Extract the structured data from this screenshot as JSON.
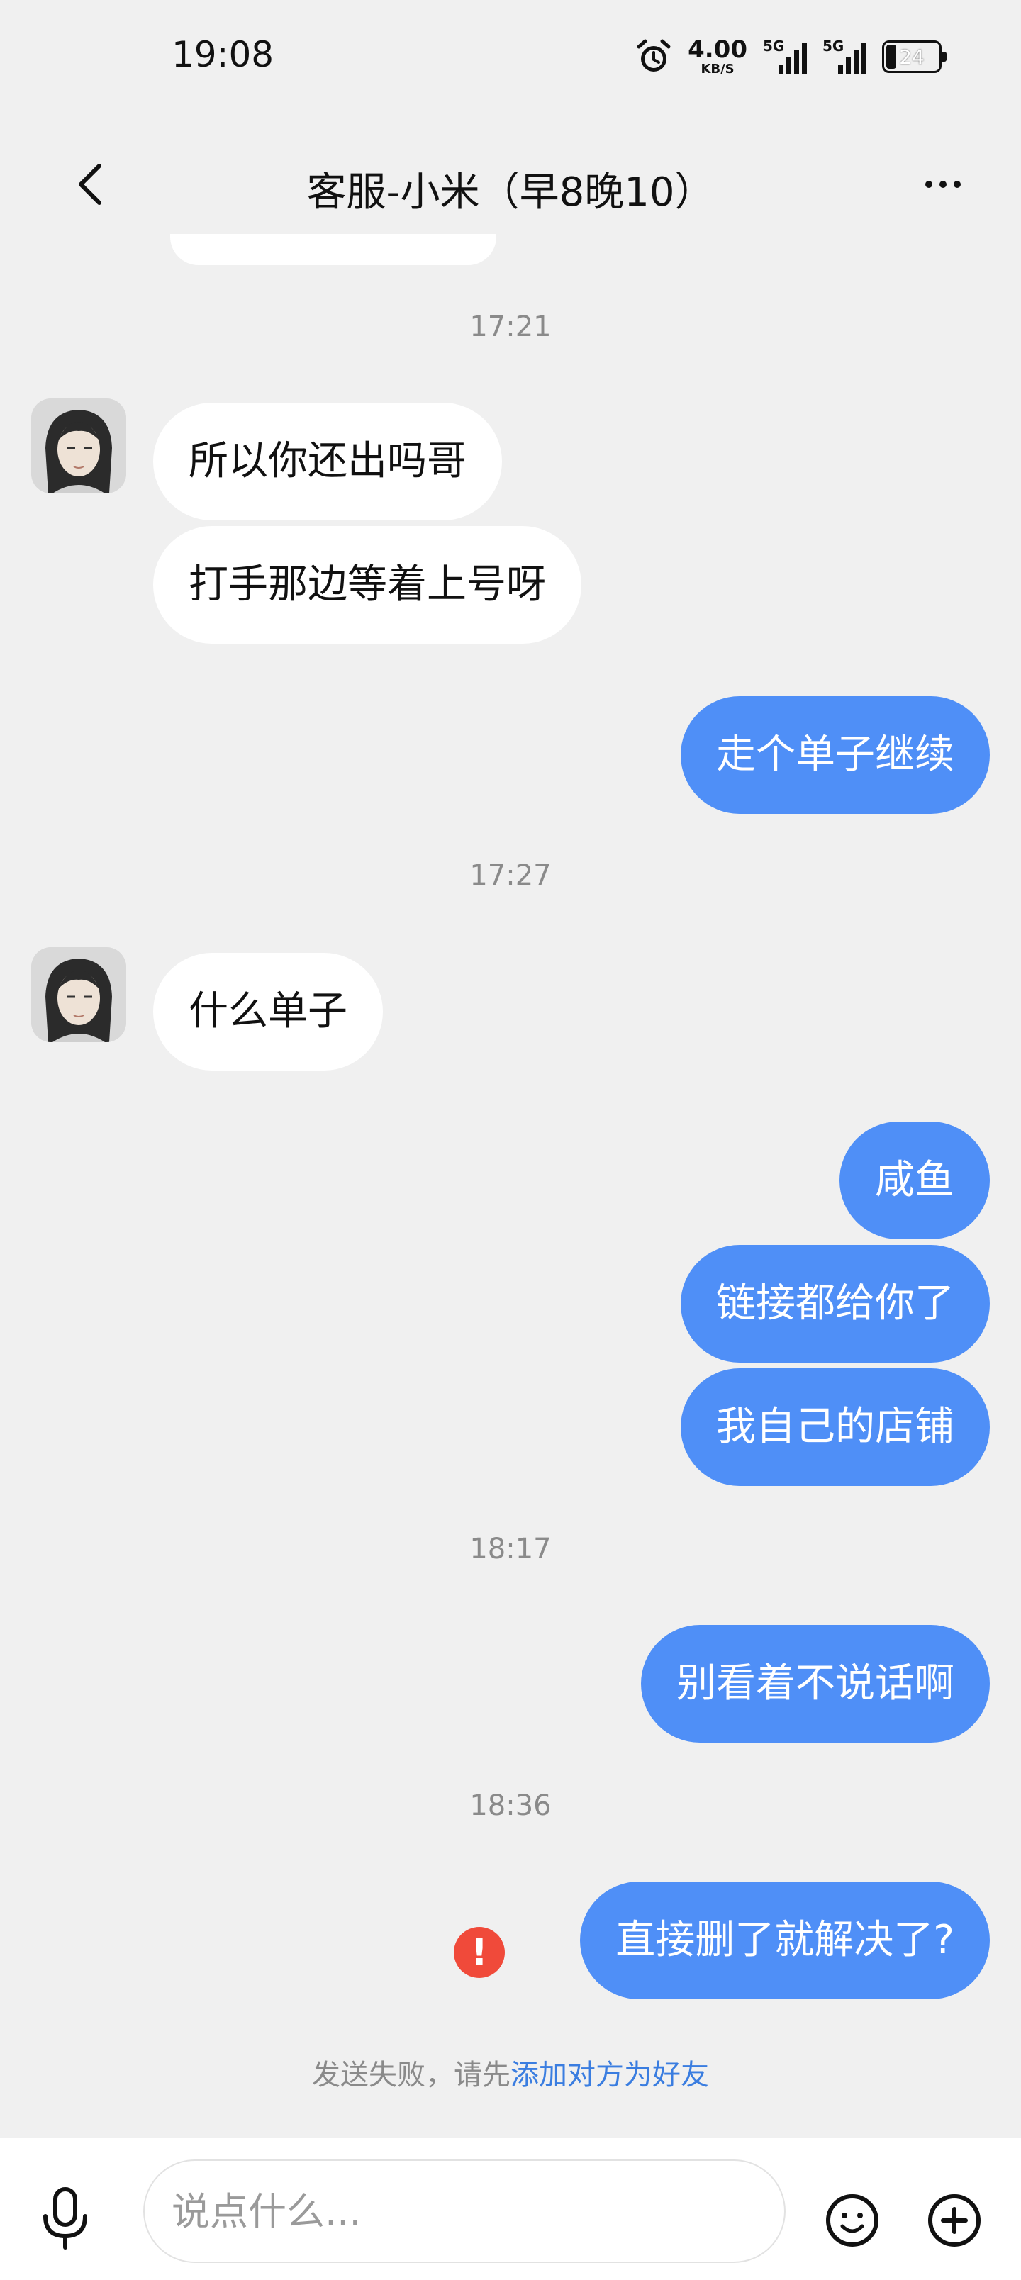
{
  "status_bar": {
    "time": "19:08",
    "net_speed_value": "4.00",
    "net_speed_unit": "KB/S",
    "signal_1_label": "5G",
    "signal_2_label": "5G",
    "battery_level": "24",
    "icons": [
      "alarm-icon",
      "signal-icon",
      "signal-icon",
      "battery-icon"
    ]
  },
  "header": {
    "title": "客服-小米（早8晚10）",
    "back_icon": "chevron-left-icon",
    "more_icon": "more-dots-icon"
  },
  "messages": {
    "ts1": "17:21",
    "in1": "所以你还出吗哥",
    "in2": "打手那边等着上号呀",
    "out1": "走个单子继续",
    "ts2": "17:27",
    "in3": "什么单子",
    "out2": "咸鱼",
    "out3": "链接都给你了",
    "out4": "我自己的店铺",
    "ts3": "18:17",
    "out5": "别看着不说话啊",
    "ts4": "18:36",
    "out6": "直接删了就解决了?",
    "error_mark": "!"
  },
  "failure_notice": {
    "prefix": "发送失败，请先",
    "link": "添加对方为好友"
  },
  "input_bar": {
    "placeholder": "说点什么...",
    "icons": [
      "microphone-icon",
      "emoji-icon",
      "plus-icon"
    ]
  },
  "colors": {
    "background": "#f0f0f0",
    "outgoing_bubble": "#4f8ff7",
    "incoming_bubble": "#ffffff",
    "error": "#f04a3a",
    "link": "#3a7de0"
  }
}
